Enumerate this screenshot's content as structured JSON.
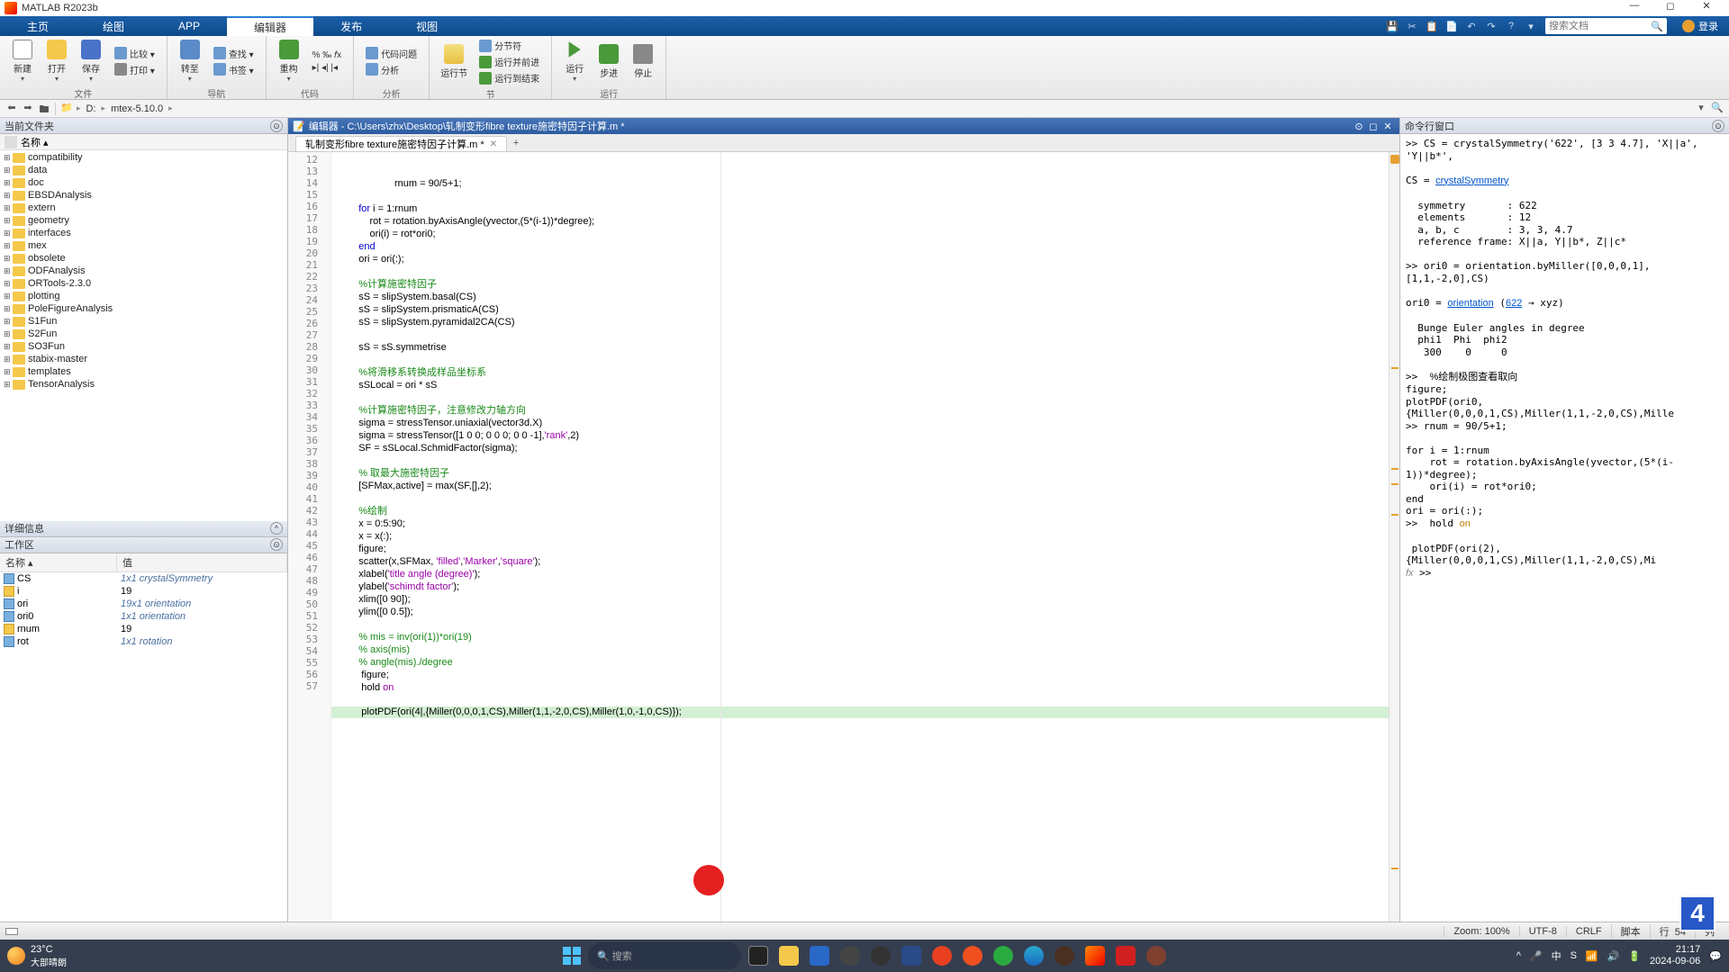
{
  "titlebar": {
    "app": "MATLAB R2023b"
  },
  "ribbon": {
    "tabs": [
      "主页",
      "绘图",
      "APP",
      "编辑器",
      "发布",
      "视图"
    ],
    "active": 3,
    "search_ph": "搜索文档",
    "login": "登录"
  },
  "toolstrip": {
    "g_file": {
      "label": "文件",
      "new": "新建",
      "open": "打开",
      "save": "保存",
      "compare": "比较 ▾",
      "print": "打印 ▾"
    },
    "g_nav": {
      "label": "导航",
      "goto": "转至",
      "find": "查找 ▾",
      "bookmark": "书签 ▾"
    },
    "g_code": {
      "label": "代码",
      "refactor": "重构",
      "fx": "% ‰ 𝑓x",
      "indent": "▸| ◂| |◂"
    },
    "g_analyze": {
      "label": "分析",
      "analyzer": "代码问题",
      "analyze": "分析"
    },
    "g_section": {
      "label": "节",
      "runsec": "运行节",
      "break": "分节符",
      "runadv": "运行并前进",
      "runend": "运行到结束"
    },
    "g_run": {
      "label": "运行",
      "run": "运行",
      "step": "步进",
      "stop": "停止"
    }
  },
  "addr": {
    "segments": [
      "D:",
      "mtex-5.10.0"
    ]
  },
  "currentfolder": {
    "title": "当前文件夹",
    "colhead": "名称 ▴",
    "items": [
      "compatibility",
      "data",
      "doc",
      "EBSDAnalysis",
      "extern",
      "geometry",
      "interfaces",
      "mex",
      "obsolete",
      "ODFAnalysis",
      "ORTools-2.3.0",
      "plotting",
      "PoleFigureAnalysis",
      "S1Fun",
      "S2Fun",
      "SO3Fun",
      "stabix-master",
      "templates",
      "TensorAnalysis"
    ]
  },
  "details": {
    "title": "详细信息"
  },
  "workspace": {
    "title": "工作区",
    "cols": [
      "名称 ▴",
      "值"
    ],
    "rows": [
      {
        "icon": "cell",
        "name": "CS",
        "value": "1x1 crystalSymmetry",
        "italic": true
      },
      {
        "icon": "arr",
        "name": "i",
        "value": "19"
      },
      {
        "icon": "cell",
        "name": "ori",
        "value": "19x1 orientation",
        "italic": true
      },
      {
        "icon": "cell",
        "name": "ori0",
        "value": "1x1 orientation",
        "italic": true
      },
      {
        "icon": "arr",
        "name": "rnum",
        "value": "19"
      },
      {
        "icon": "cell",
        "name": "rot",
        "value": "1x1 rotation",
        "italic": true
      }
    ]
  },
  "editor": {
    "title": "编辑器 - C:\\Users\\zhx\\Desktop\\轧制变形fibre texture施密特因子计算.m *",
    "tab": "轧制变形fibre texture施密特因子计算.m *",
    "first_line": 12,
    "highlight_line": 54,
    "lines": [
      {
        "t": "p",
        "c": "    rnum = 90/5+1;"
      },
      {
        "t": "p",
        "c": ""
      },
      {
        "t": "k",
        "c": "    for i = 1:rnum"
      },
      {
        "t": "p",
        "c": "        rot = rotation.byAxisAngle(yvector,(5*(i-1))*degree);"
      },
      {
        "t": "p",
        "c": "        ori(i) = rot*ori0;"
      },
      {
        "t": "k",
        "c": "    end"
      },
      {
        "t": "p",
        "c": "    ori = ori(:);"
      },
      {
        "t": "p",
        "c": ""
      },
      {
        "t": "c",
        "c": "    %计算施密特因子"
      },
      {
        "t": "p",
        "c": "    sS = slipSystem.basal(CS)"
      },
      {
        "t": "p",
        "c": "    sS = slipSystem.prismaticA(CS)"
      },
      {
        "t": "p",
        "c": "    sS = slipSystem.pyramidal2CA(CS)"
      },
      {
        "t": "p",
        "c": ""
      },
      {
        "t": "p",
        "c": "    sS = sS.symmetrise"
      },
      {
        "t": "p",
        "c": ""
      },
      {
        "t": "c",
        "c": "    %将滑移系转换成样品坐标系"
      },
      {
        "t": "p",
        "c": "    sSLocal = ori * sS"
      },
      {
        "t": "p",
        "c": ""
      },
      {
        "t": "c",
        "c": "    %计算施密特因子，注意修改力轴方向"
      },
      {
        "t": "p",
        "c": "    sigma = stressTensor.uniaxial(vector3d.X)"
      },
      {
        "t": "m",
        "c": "    sigma = stressTensor([1 0 0; 0 0 0; 0 0 -1],'rank',2)"
      },
      {
        "t": "p",
        "c": "    SF = sSLocal.SchmidFactor(sigma);"
      },
      {
        "t": "p",
        "c": ""
      },
      {
        "t": "c",
        "c": "    % 取最大施密特因子"
      },
      {
        "t": "p",
        "c": "    [SFMax,active] = max(SF,[],2);"
      },
      {
        "t": "p",
        "c": ""
      },
      {
        "t": "c",
        "c": "    %绘制"
      },
      {
        "t": "p",
        "c": "    x = 0:5:90;"
      },
      {
        "t": "p",
        "c": "    x = x(:);"
      },
      {
        "t": "p",
        "c": "    figure;"
      },
      {
        "t": "m",
        "c": "    scatter(x,SFMax, 'filled','Marker','square');"
      },
      {
        "t": "m",
        "c": "    xlabel('title angle (degree)');"
      },
      {
        "t": "m",
        "c": "    ylabel('schimdt factor');"
      },
      {
        "t": "p",
        "c": "    xlim([0 90]);"
      },
      {
        "t": "p",
        "c": "    ylim([0 0.5]);"
      },
      {
        "t": "p",
        "c": ""
      },
      {
        "t": "c",
        "c": "    % mis = inv(ori(1))*ori(19)"
      },
      {
        "t": "c",
        "c": "    % axis(mis)"
      },
      {
        "t": "c",
        "c": "    % angle(mis)./degree"
      },
      {
        "t": "p",
        "c": "     figure;"
      },
      {
        "t": "k2",
        "c": "     hold on"
      },
      {
        "t": "p",
        "c": ""
      },
      {
        "t": "p",
        "c": "     plotPDF(ori(4|,{Miller(0,0,0,1,CS),Miller(1,1,-2,0,CS),Miller(1,0,-1,0,CS)});"
      },
      {
        "t": "p",
        "c": ""
      },
      {
        "t": "p",
        "c": ""
      },
      {
        "t": "p",
        "c": ""
      }
    ]
  },
  "cmdwin": {
    "title": "命令行窗口",
    "out": [
      ">> CS = crystalSymmetry('622', [3 3 4.7], 'X||a', 'Y||b*', ",
      " ",
      "CS = <link>crystalSymmetry</link>",
      " ",
      "  symmetry       : 622",
      "  elements       : 12",
      "  a, b, c        : 3, 3, 4.7",
      "  reference frame: X||a, Y||b*, Z||c*",
      " ",
      ">> ori0 = orientation.byMiller([0,0,0,1],[1,1,-2,0],CS)",
      " ",
      "ori0 = <link>orientation</link> (<link>622</link> → xyz)",
      " ",
      "  Bunge Euler angles in degree",
      "  phi1  Phi  phi2",
      "   300    0     0",
      " ",
      ">>  <c>%绘制极图查看取向</c>",
      "figure;",
      "plotPDF(ori0,{Miller(0,0,0,1,CS),Miller(1,1,-2,0,CS),Mille",
      ">> rnum = 90/5+1;",
      " ",
      "for i = 1:rnum",
      "    rot = rotation.byAxisAngle(yvector,(5*(i-1))*degree);",
      "    ori(i) = rot*ori0;",
      "end",
      "ori = ori(:);",
      ">>  hold <warn>on</warn>",
      " ",
      " plotPDF(ori(2),{Miller(0,0,0,1,CS),Miller(1,1,-2,0,CS),Mi",
      "<fx>fx</fx> >> "
    ]
  },
  "status": {
    "zoom": "Zoom: 100%",
    "enc": "UTF-8",
    "eol": "CRLF",
    "type": "脚本",
    "line": "行",
    "linev": "54",
    "col": "列"
  },
  "taskbar": {
    "temp": "23°C",
    "cond": "大部晴朗",
    "search": "搜索",
    "time": "21:17",
    "date": "2024-09-06"
  },
  "overlay": {
    "num": "4"
  }
}
